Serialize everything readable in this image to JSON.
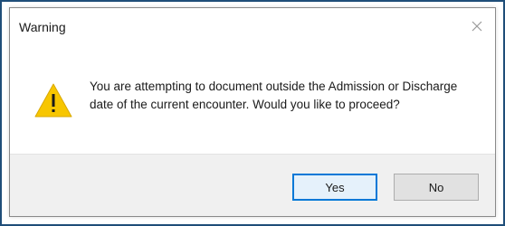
{
  "dialog": {
    "title": "Warning",
    "close_icon": "close-icon",
    "warning_icon": "warning-triangle-icon",
    "message": "You are attempting to document outside the Admission or Discharge date of the current encounter. Would you like to proceed?",
    "buttons": {
      "yes_label": "Yes",
      "no_label": "No"
    }
  },
  "colors": {
    "frame_border": "#1f4e79",
    "footer_background": "#f0f0f0",
    "default_button_border": "#0078d7",
    "warning_yellow": "#f7c600"
  }
}
